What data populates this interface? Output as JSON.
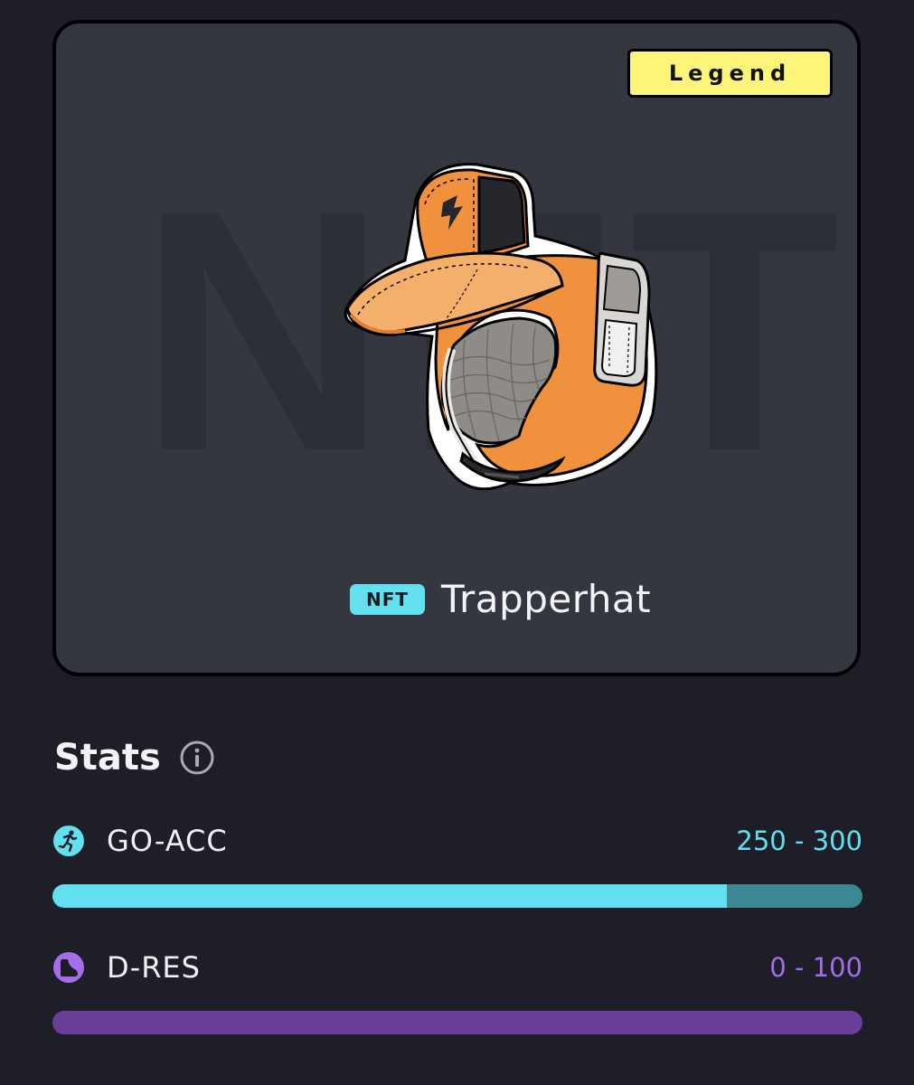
{
  "card": {
    "watermark": "NFT",
    "rarity": "Legend",
    "nft_label": "NFT",
    "item_name": "Trapperhat",
    "item_image": "trapper-hat-illustration"
  },
  "stats": {
    "title": "Stats",
    "info_icon": "info-icon",
    "items": [
      {
        "name": "GO-ACC",
        "range": "250 - 300",
        "icon": "running-person-icon",
        "fill_fraction": 0.833,
        "color": "#63e0ef",
        "track_color": "#3c8791"
      },
      {
        "name": "D-RES",
        "range": "0 - 100",
        "icon": "shoe-icon",
        "fill_fraction": 0,
        "color": "#a46ee8",
        "track_color": "#6a3f99"
      }
    ]
  }
}
